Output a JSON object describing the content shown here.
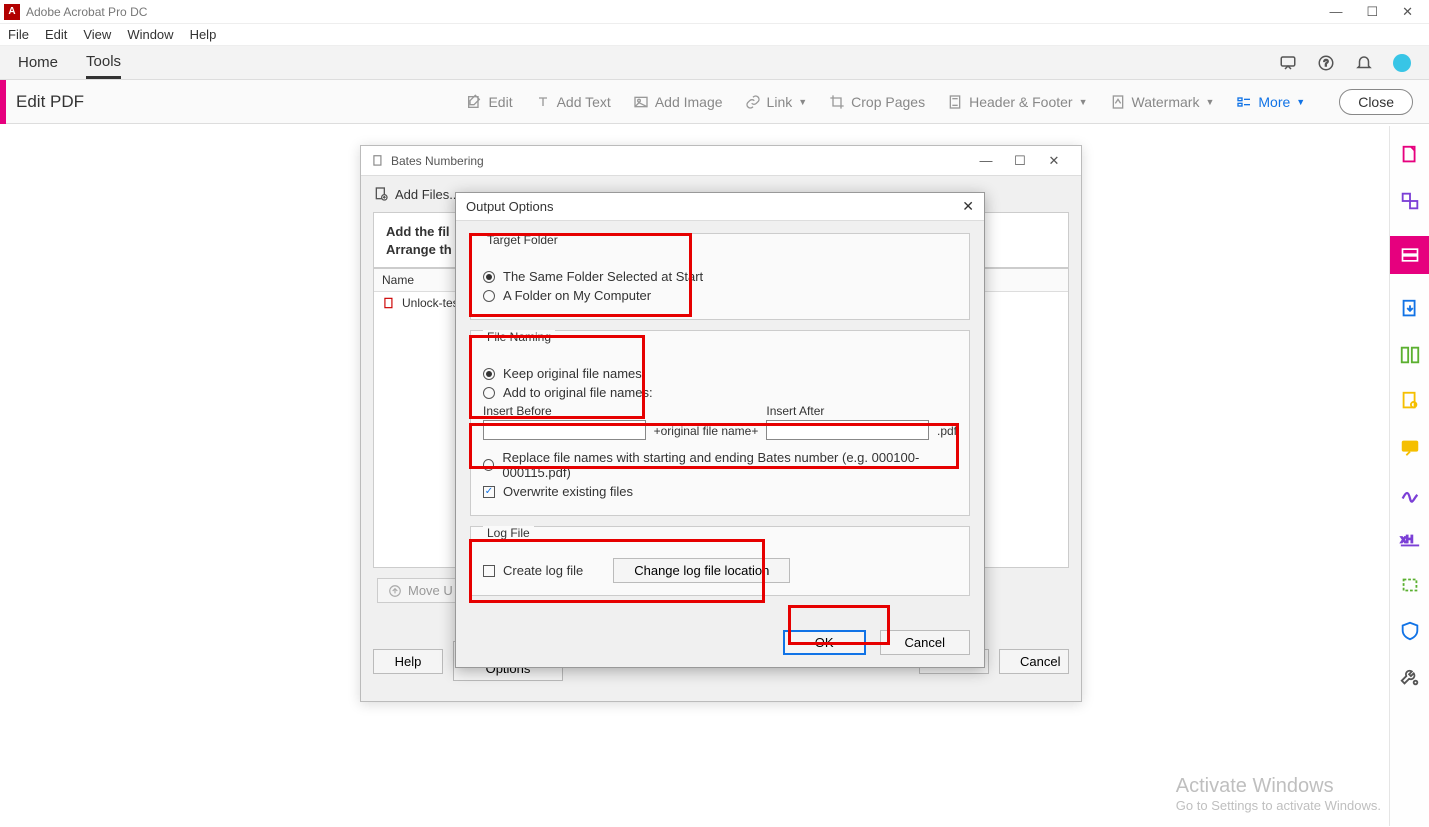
{
  "app": {
    "title": "Adobe Acrobat Pro DC"
  },
  "menubar": [
    "File",
    "Edit",
    "View",
    "Window",
    "Help"
  ],
  "tabs": {
    "home": "Home",
    "tools": "Tools"
  },
  "toolbar": {
    "section": "Edit PDF",
    "edit": "Edit",
    "addText": "Add Text",
    "addImage": "Add Image",
    "link": "Link",
    "cropPages": "Crop Pages",
    "headerFooter": "Header & Footer",
    "watermark": "Watermark",
    "more": "More",
    "close": "Close"
  },
  "bates": {
    "title": "Bates Numbering",
    "addFiles": "Add Files...",
    "instruction1": "Add the fil",
    "instruction2": "Arrange th",
    "nameHeader": "Name",
    "fileRow": "Unlock-test",
    "moveUp": "Move U",
    "help": "Help",
    "outputOptions": "Output Options",
    "ok": "OK",
    "cancel": "Cancel"
  },
  "output": {
    "title": "Output Options",
    "targetFolder": {
      "legend": "Target Folder",
      "opt1": "The Same Folder Selected at Start",
      "opt2": "A Folder on My Computer"
    },
    "fileNaming": {
      "legend": "File Naming",
      "opt1": "Keep original file names",
      "opt2": "Add to original file names:",
      "insertBefore": "Insert Before",
      "insertAfter": "Insert After",
      "middle": "+original file name+",
      "ext": ".pdf",
      "replace": "Replace file names with starting and ending Bates number (e.g. 000100-000115.pdf)",
      "overwrite": "Overwrite existing files"
    },
    "logFile": {
      "legend": "Log File",
      "create": "Create log file",
      "changeLoc": "Change log file location"
    },
    "ok": "OK",
    "cancel": "Cancel"
  },
  "watermark": {
    "l1": "Activate Windows",
    "l2": "Go to Settings to activate Windows."
  }
}
